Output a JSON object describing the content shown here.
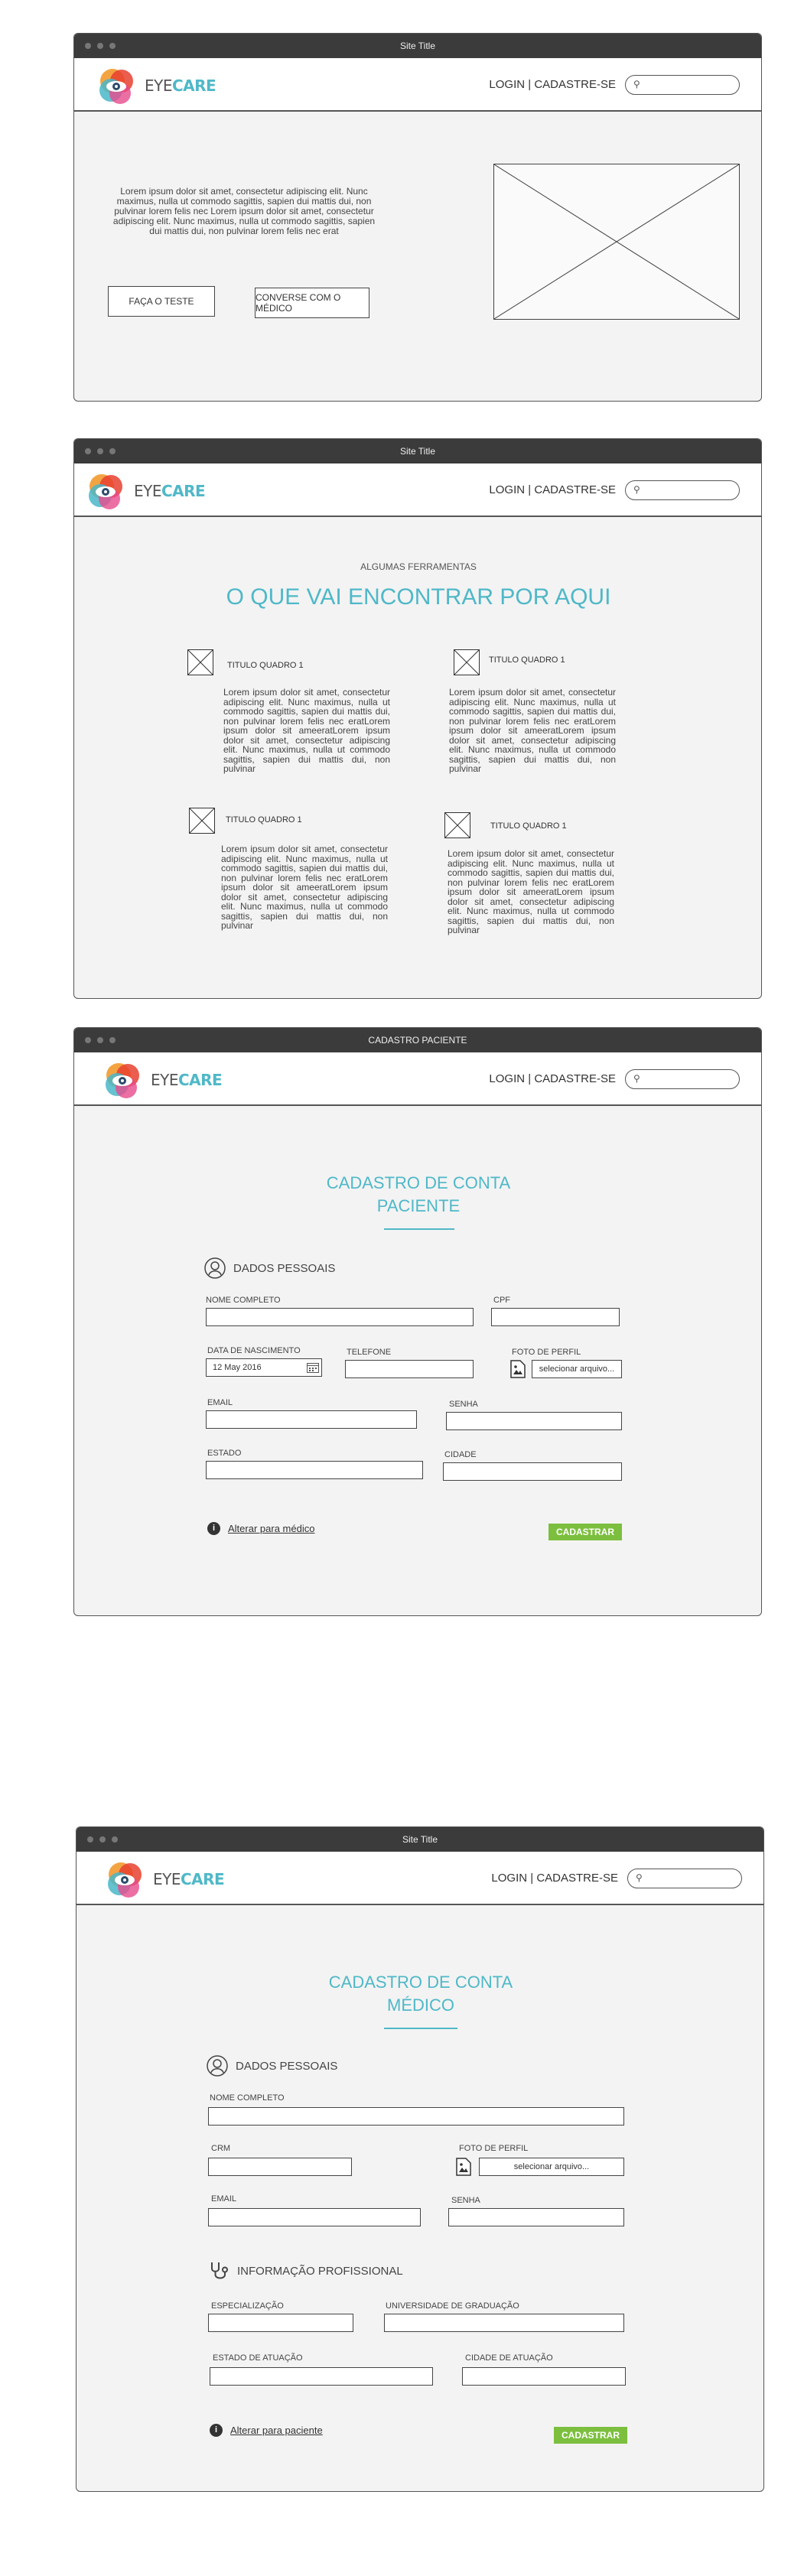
{
  "common": {
    "site_title": "Site Title",
    "logo": {
      "eye": "EYE",
      "care": "CARE"
    },
    "auth_links": "LOGIN | CADASTRE-SE"
  },
  "home": {
    "lorem": "Lorem ipsum dolor sit amet, consectetur adipiscing elit. Nunc maximus, nulla ut commodo sagittis, sapien dui mattis dui, non pulvinar lorem felis nec Lorem ipsum dolor sit amet, consectetur adipiscing elit. Nunc maximus, nulla ut commodo sagittis, sapien dui mattis dui, non pulvinar lorem felis nec erat",
    "test_button": "FAÇA O TESTE",
    "doctor_button": "CONVERSE COM O MÉDICO"
  },
  "tools": {
    "subtitle": "ALGUMAS FERRAMENTAS",
    "title": "O QUE VAI ENCONTRAR POR AQUI",
    "cards": [
      {
        "title": "TITULO QUADRO 1",
        "body": "Lorem ipsum dolor sit amet, consectetur adipiscing elit. Nunc maximus, nulla ut commodo sagittis, sapien dui mattis dui, non pulvinar lorem felis nec eratLorem ipsum dolor sit ameeratLorem ipsum dolor sit amet, consectetur adipiscing elit. Nunc maximus, nulla ut commodo sagittis, sapien dui mattis dui, non pulvinar"
      },
      {
        "title": "TITULO QUADRO 1",
        "body": "Lorem ipsum dolor sit amet, consectetur adipiscing elit. Nunc maximus, nulla ut commodo sagittis, sapien dui mattis dui, non pulvinar lorem felis nec eratLorem ipsum dolor sit ameeratLorem ipsum dolor sit amet, consectetur adipiscing elit. Nunc maximus, nulla ut commodo sagittis, sapien dui mattis dui, non pulvinar"
      },
      {
        "title": "TITULO QUADRO 1",
        "body": "Lorem ipsum dolor sit amet, consectetur adipiscing elit. Nunc maximus, nulla ut commodo sagittis, sapien dui mattis dui, non pulvinar lorem felis nec eratLorem ipsum dolor sit ameeratLorem ipsum dolor sit amet, consectetur adipiscing elit. Nunc maximus, nulla ut commodo sagittis, sapien dui mattis dui, non pulvinar"
      },
      {
        "title": "TITULO QUADRO 1",
        "body": "Lorem ipsum dolor sit amet, consectetur adipiscing elit. Nunc maximus, nulla ut commodo sagittis, sapien dui mattis dui, non pulvinar lorem felis nec eratLorem ipsum dolor sit ameeratLorem ipsum dolor sit amet, consectetur adipiscing elit. Nunc maximus, nulla ut commodo sagittis, sapien dui mattis dui, non pulvinar"
      }
    ]
  },
  "patient": {
    "window_title": "CADASTRO PACIENTE",
    "form_title_1": "CADASTRO DE CONTA",
    "form_title_2": "PACIENTE",
    "section": "DADOS PESSOAIS",
    "labels": {
      "name": "NOME COMPLETO",
      "cpf": "CPF",
      "birth": "DATA DE NASCIMENTO",
      "phone": "TELEFONE",
      "photo": "FOTO DE PERFIL",
      "email": "EMAIL",
      "password": "SENHA",
      "state": "ESTADO",
      "city": "CIDADE"
    },
    "birth_value": "12 May 2016",
    "file_button": "selecionar arquivo...",
    "switch_link": "Alterar para médico",
    "submit": "CADASTRAR"
  },
  "doctor": {
    "form_title_1": "CADASTRO DE CONTA",
    "form_title_2": "MÉDICO",
    "section_personal": "DADOS PESSOAIS",
    "section_professional": "INFORMAÇÃO PROFISSIONAL",
    "labels": {
      "name": "NOME COMPLETO",
      "crm": "CRM",
      "photo": "FOTO DE PERFIL",
      "email": "EMAIL",
      "password": "SENHA",
      "specialization": "ESPECIALIZAÇÃO",
      "university": "UNIVERSIDADE DE GRADUAÇÃO",
      "state": "ESTADO DE ATUAÇÃO",
      "city": "CIDADE DE ATUAÇÃO"
    },
    "file_button": "selecionar arquivo...",
    "switch_link": "Alterar para paciente",
    "submit": "CADASTRAR"
  }
}
